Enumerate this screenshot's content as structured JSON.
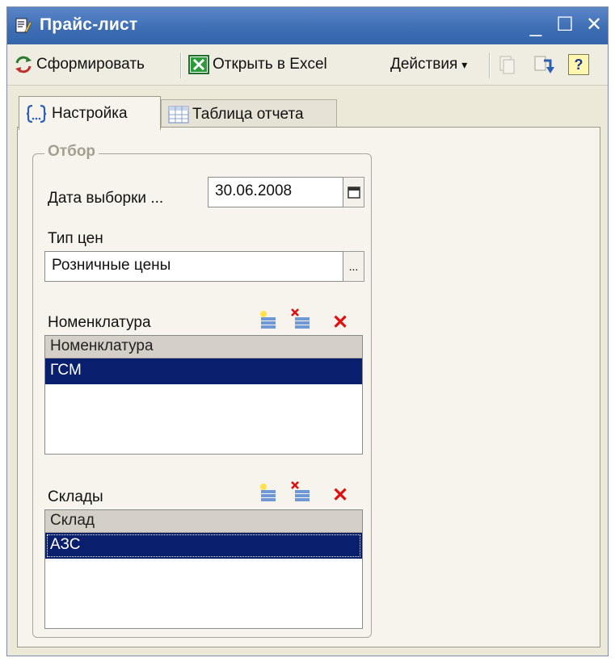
{
  "window": {
    "title": "Прайс-лист",
    "controls": {
      "minimize": "_",
      "maximize": "☐",
      "close": "✕"
    }
  },
  "toolbar": {
    "form_label": "Сформировать",
    "excel_label": "Открыть в Excel",
    "actions_label": "Действия",
    "actions_arrow": "▾",
    "help_label": "?"
  },
  "tabs": [
    {
      "label": "Настройка",
      "active": true
    },
    {
      "label": "Таблица отчета",
      "active": false
    }
  ],
  "filter": {
    "legend": "Отбор",
    "date_label": "Дата выборки ...",
    "date_value": "30.06.2008",
    "price_type_label": "Тип цен",
    "price_type_value": "Розничные цены",
    "select_btn": "...",
    "nomenclature": {
      "label": "Номенклатура",
      "column": "Номенклатура",
      "rows": [
        "ГСМ"
      ]
    },
    "warehouses": {
      "label": "Склады",
      "column": "Склад",
      "rows": [
        "АЗС"
      ]
    },
    "delete_icon": "✕"
  },
  "colors": {
    "title_bar": "#3c6db3",
    "selection": "#0a1e6e",
    "delete_red": "#e01010",
    "excel_green": "#1f8a2e"
  }
}
